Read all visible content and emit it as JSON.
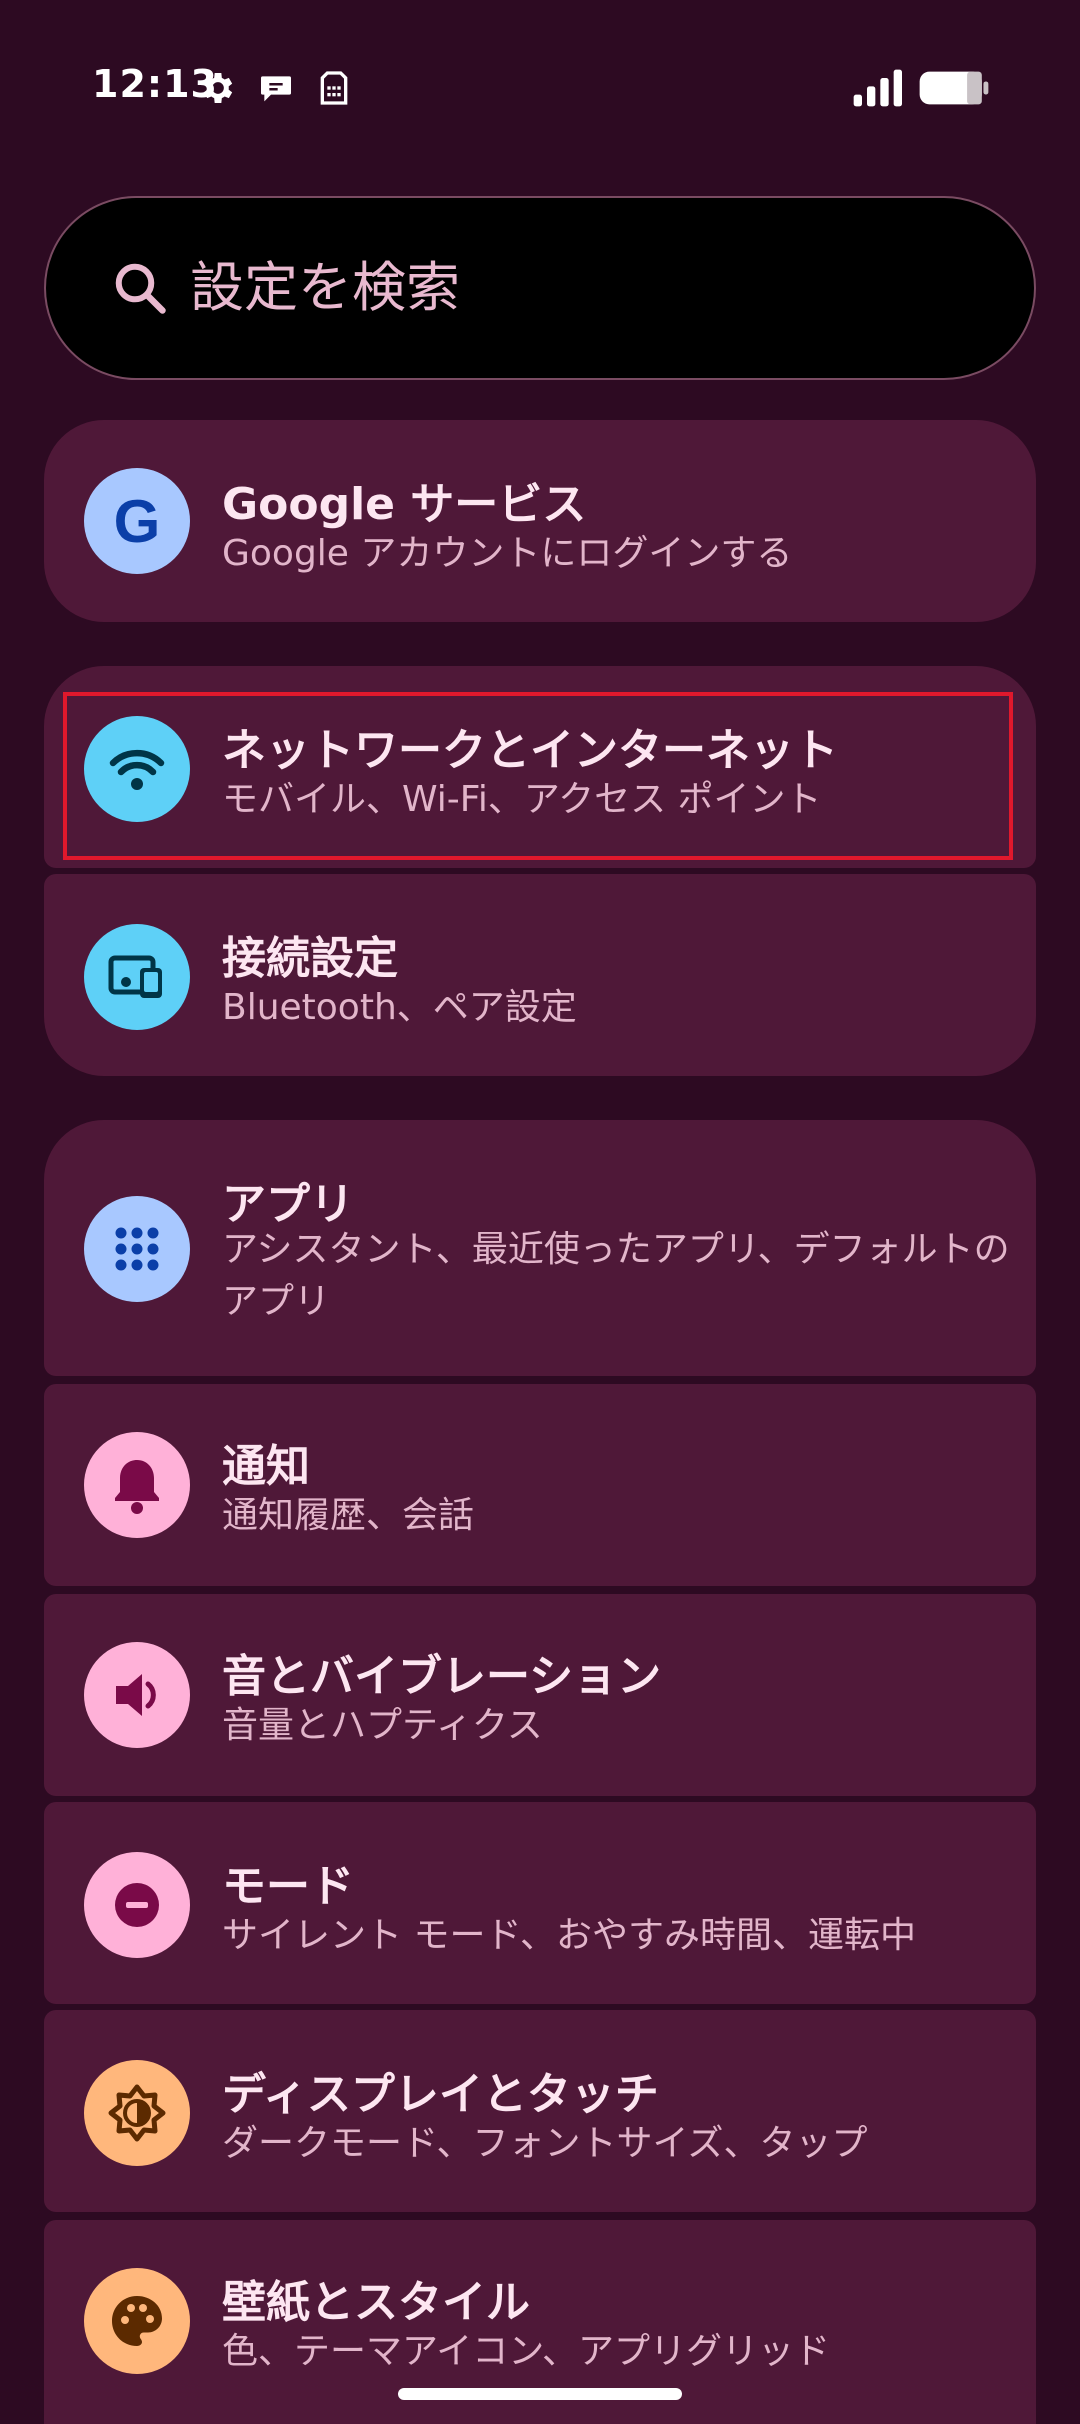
{
  "status_bar": {
    "time": "12:13"
  },
  "search": {
    "placeholder": "設定を検索"
  },
  "items": [
    {
      "key": "google",
      "title": "Google サービス",
      "subtitle": "Google アカウントにログインする",
      "icon": "google-icon",
      "icon_bg": "#a8c8ff",
      "icon_fg": "#0b3fa8"
    },
    {
      "key": "network",
      "title": "ネットワークとインターネット",
      "subtitle": "モバイル、Wi-Fi、アクセス ポイント",
      "icon": "wifi-icon",
      "icon_bg": "#5ed0f7",
      "icon_fg": "#003547"
    },
    {
      "key": "connected",
      "title": "接続設定",
      "subtitle": "Bluetooth、ペア設定",
      "icon": "connected-devices-icon",
      "icon_bg": "#5ed0f7",
      "icon_fg": "#003547"
    },
    {
      "key": "apps",
      "title": "アプリ",
      "subtitle": "アシスタント、最近使ったアプリ、デフォルトのアプリ",
      "icon": "apps-grid-icon",
      "icon_bg": "#a8c8ff",
      "icon_fg": "#0b3fa8"
    },
    {
      "key": "notifications",
      "title": "通知",
      "subtitle": "通知履歴、会話",
      "icon": "bell-icon",
      "icon_bg": "#ffb1d8",
      "icon_fg": "#7a0a48"
    },
    {
      "key": "sound",
      "title": "音とバイブレーション",
      "subtitle": "音量とハプティクス",
      "icon": "speaker-icon",
      "icon_bg": "#ffb1d8",
      "icon_fg": "#7a0a48"
    },
    {
      "key": "modes",
      "title": "モード",
      "subtitle": "サイレント モード、おやすみ時間、運転中",
      "icon": "do-not-disturb-icon",
      "icon_bg": "#ffb1d8",
      "icon_fg": "#7a0a48"
    },
    {
      "key": "display",
      "title": "ディスプレイとタッチ",
      "subtitle": "ダークモード、フォントサイズ、タップ",
      "icon": "brightness-icon",
      "icon_bg": "#ffb77c",
      "icon_fg": "#5c2a00"
    },
    {
      "key": "wallpaper",
      "title": "壁紙とスタイル",
      "subtitle": "色、テーマアイコン、アプリグリッド",
      "icon": "palette-icon",
      "icon_bg": "#ffb77c",
      "icon_fg": "#5c2a00"
    }
  ],
  "colors": {
    "background": "#2d0a22",
    "card": "#4f1838",
    "highlight": "#e0182c"
  }
}
